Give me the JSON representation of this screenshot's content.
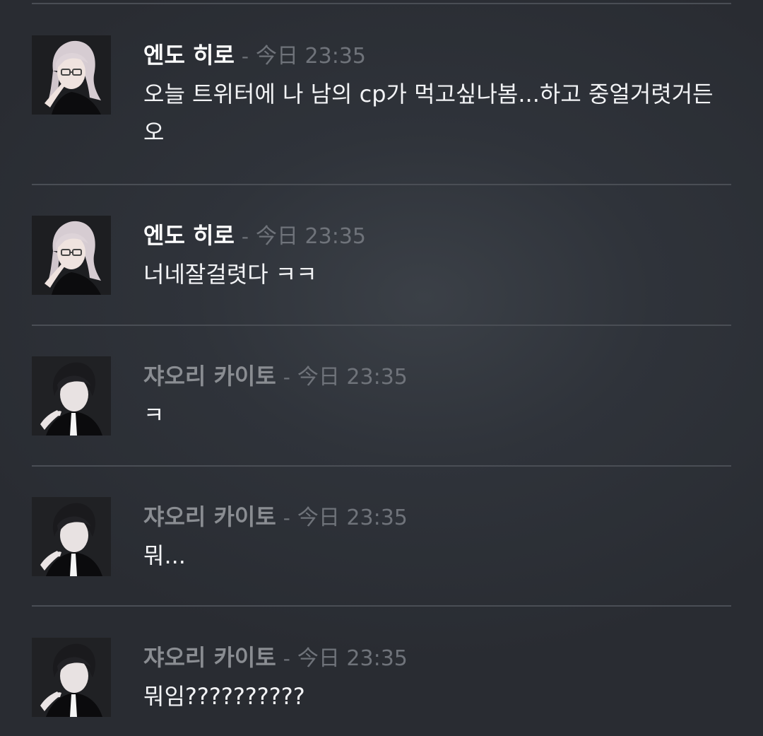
{
  "messages": [
    {
      "author": "엔도 히로",
      "separator": "-",
      "time": "今日 23:35",
      "text": "오늘 트위터에 나 남의 cp가 먹고싶나봄...하고 중얼거렷거든오",
      "avatar": "white-hair-glasses-avatar"
    },
    {
      "author": "엔도 히로",
      "separator": "-",
      "time": "今日 23:35",
      "text": "너네잘걸렷다 ㅋㅋ",
      "avatar": "white-hair-glasses-avatar"
    },
    {
      "author": "쟈오리 카이토",
      "separator": "-",
      "time": "今日 23:35",
      "text": "ㅋ",
      "avatar": "dark-hair-suit-avatar"
    },
    {
      "author": "쟈오리 카이토",
      "separator": "-",
      "time": "今日 23:35",
      "text": "뭐...",
      "avatar": "dark-hair-suit-avatar"
    },
    {
      "author": "쟈오리 카이토",
      "separator": "-",
      "time": "今日 23:35",
      "text": "뭐임??????????",
      "avatar": "dark-hair-suit-avatar"
    }
  ]
}
